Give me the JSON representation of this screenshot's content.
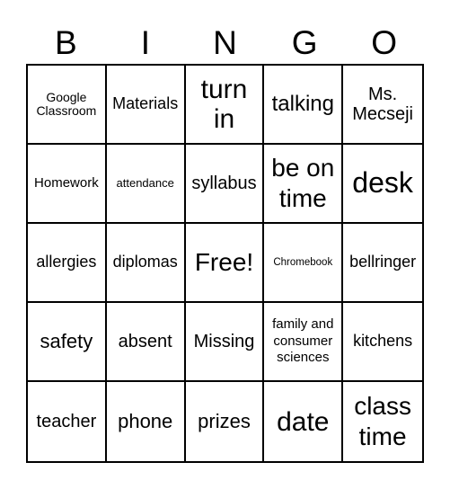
{
  "header": {
    "letters": [
      "B",
      "I",
      "N",
      "G",
      "O"
    ]
  },
  "board": {
    "rows": [
      [
        "Google Classroom",
        "Materials",
        "turn in",
        "talking",
        "Ms. Mecseji"
      ],
      [
        "Homework",
        "attendance",
        "syllabus",
        "be on time",
        "desk"
      ],
      [
        "allergies",
        "diplomas",
        "Free!",
        "Chromebook",
        "bellringer"
      ],
      [
        "safety",
        "absent",
        "Missing",
        "family and consumer sciences",
        "kitchens"
      ],
      [
        "teacher",
        "phone",
        "prizes",
        "date",
        "class time"
      ]
    ]
  }
}
